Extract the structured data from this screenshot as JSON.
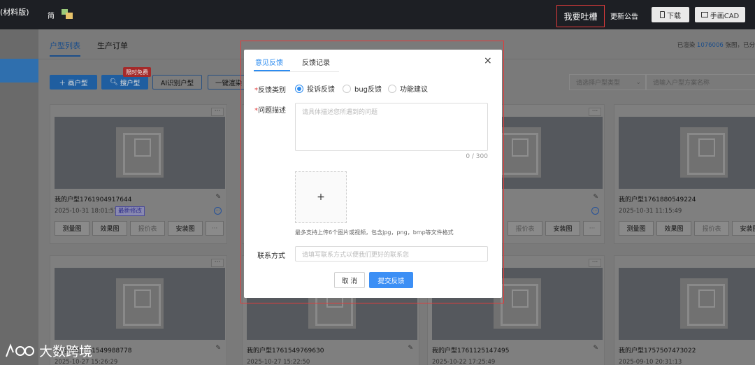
{
  "header": {
    "app_title": "(材料版)",
    "lang_short": "简",
    "complain": "我要吐槽",
    "notice": "更新公告",
    "download": "下载",
    "cad": "手画CAD"
  },
  "tabs": [
    "户型列表",
    "生产订单"
  ],
  "usage": {
    "prefix": "已渲染",
    "count": "1076006",
    "suffix": "张图，已分"
  },
  "actions": {
    "draw": "＋ 画户型",
    "search": "搜户型",
    "badge": "限时免费",
    "ai": "AI识别户型",
    "oneclick": "一键渲染"
  },
  "filters": {
    "type_placeholder": "请选择户型类型",
    "name_placeholder": "请输入户型方案名称"
  },
  "cards": [
    {
      "name": "我的户型1761904917644",
      "date": "2025-10-31 18:01:57",
      "tag": "最新修改"
    },
    {
      "name": "我的户型1761880549224",
      "date": "2025-10-31 11:15:49",
      "tag": ""
    },
    {
      "name": "我的户型1761549988778",
      "date": "2025-10-27 15:26:29",
      "tag": ""
    },
    {
      "name": "我的户型1761549769630",
      "date": "2025-10-27 15:22:50",
      "tag": ""
    },
    {
      "name": "我的户型1761125147495",
      "date": "2025-10-22 17:25:49",
      "tag": ""
    },
    {
      "name": "我的户型1757507473022",
      "date": "2025-09-10 20:31:13",
      "tag": ""
    }
  ],
  "card_buttons": [
    "测量图",
    "效果图",
    "报价表",
    "安装图",
    "···"
  ],
  "modal": {
    "tab_feedback": "意见反馈",
    "tab_records": "反馈记录",
    "close": "×",
    "type_label": "反馈类别",
    "type_options": [
      "投诉反馈",
      "bug反馈",
      "功能建议"
    ],
    "selected_index": 0,
    "desc_label": "问题描述",
    "desc_placeholder": "请具体描述您所遇到的问题",
    "counter": "0 / 300",
    "upload_plus": "+",
    "upload_hint": "最多支持上传6个图片或视频，包含jpg，png，bmp等文件格式",
    "contact_label": "联系方式",
    "contact_placeholder": "请填写联系方式以便我们更好的联系您",
    "cancel": "取 消",
    "submit": "提交反馈"
  },
  "watermark": "大数跨境",
  "colors": {
    "accent": "#2d8cf0",
    "highlight": "#e23b3b",
    "topbar": "#1d1f24"
  }
}
